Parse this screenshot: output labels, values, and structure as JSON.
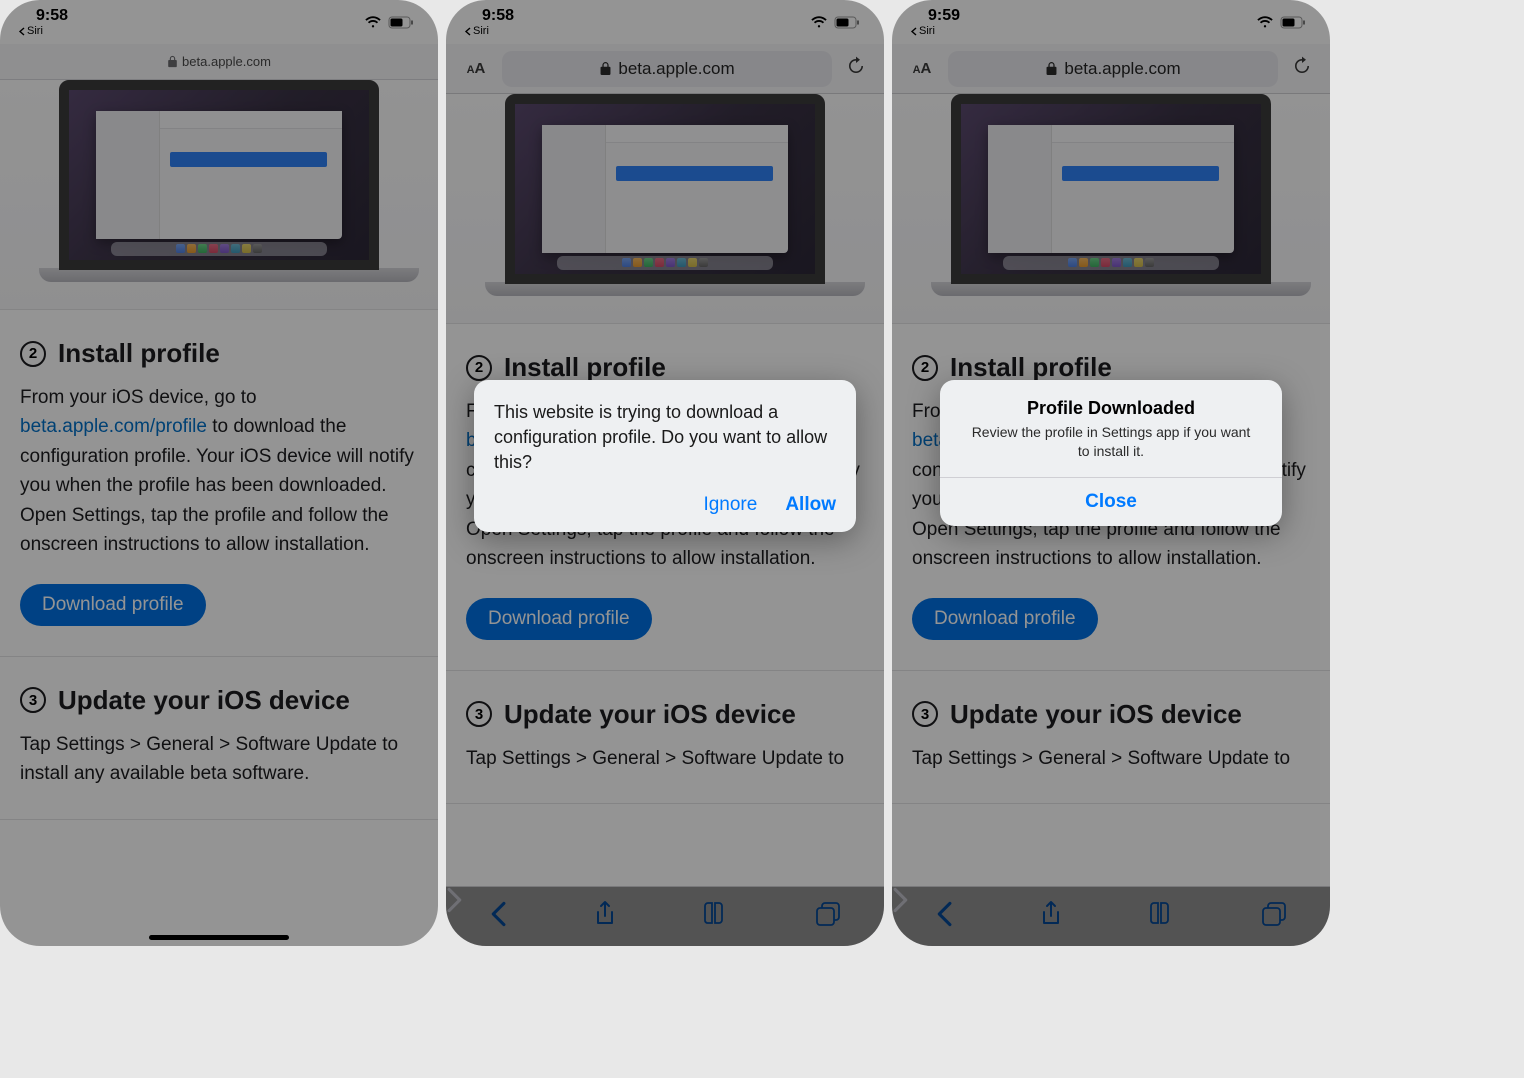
{
  "screens": [
    {
      "time": "9:58",
      "back_app": "Siri",
      "url": "beta.apple.com",
      "url_bar_style": "minimal",
      "step2_num": "2",
      "step2_title": "Install profile",
      "step2_body_pre": "From your iOS device, go to ",
      "step2_link": "beta.apple.com/profile",
      "step2_body_post": " to download the configuration profile. Your iOS device will notify you when the profile has been downloaded. Open Settings, tap the profile and follow the onscreen instructions to allow installation.",
      "download_btn": "Download profile",
      "step3_num": "3",
      "step3_title": "Update your iOS device",
      "step3_body": "Tap Settings > General > Software Update to install any available beta software."
    },
    {
      "time": "9:58",
      "back_app": "Siri",
      "url": "beta.apple.com",
      "url_bar_style": "full",
      "step2_num": "2",
      "step2_title": "Install profile",
      "step2_body_pre": "From your iOS device, go to ",
      "step2_link": "beta.apple.com/profile",
      "step2_body_post": " to download the configuration profile. Your iOS device will notify you when the profile has been downloaded. Open Settings, tap the profile and follow the onscreen instructions to allow installation.",
      "download_btn": "Download profile",
      "step3_num": "3",
      "step3_title": "Update your iOS device",
      "step3_body": "Tap Settings > General > Software Update to",
      "alert_msg": "This website is trying to download a configuration profile. Do you want to allow this?",
      "alert_ignore": "Ignore",
      "alert_allow": "Allow"
    },
    {
      "time": "9:59",
      "back_app": "Siri",
      "url": "beta.apple.com",
      "url_bar_style": "full",
      "step2_num": "2",
      "step2_title": "Install profile",
      "step2_body_pre": "From your iOS device, go to ",
      "step2_link": "beta.apple.com/profile",
      "step2_body_post": " to download the configuration profile. Your iOS device will notify you when the profile has been downloaded. Open Settings, tap the profile and follow the onscreen instructions to allow installation.",
      "download_btn": "Download profile",
      "step3_num": "3",
      "step3_title": "Update your iOS device",
      "step3_body": "Tap Settings > General > Software Update to",
      "alert2_title": "Profile Downloaded",
      "alert2_sub": "Review the profile in Settings app if you want to install it.",
      "alert2_close": "Close"
    }
  ]
}
